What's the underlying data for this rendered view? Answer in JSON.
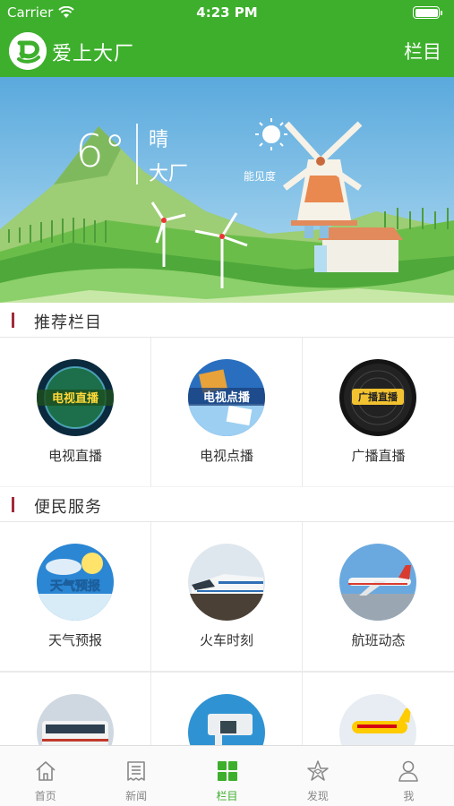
{
  "status_bar": {
    "carrier": "Carrier",
    "time": "4:23 PM"
  },
  "nav": {
    "title": "爱上大厂",
    "right_label": "栏目"
  },
  "weather": {
    "temperature": "6°",
    "condition": "晴",
    "city": "大厂",
    "visibility": "能见度"
  },
  "sections": [
    {
      "title": "推荐栏目",
      "items": [
        {
          "label": "电视直播",
          "icon": "tv-live-thumb",
          "thumb_text": "电视直播"
        },
        {
          "label": "电视点播",
          "icon": "tv-vod-thumb",
          "thumb_text": "电视点播"
        },
        {
          "label": "广播直播",
          "icon": "radio-live-thumb",
          "thumb_text": "广播直播"
        }
      ]
    },
    {
      "title": "便民服务",
      "items": [
        {
          "label": "天气预报",
          "icon": "weather-forecast-thumb",
          "thumb_text": "天气预报"
        },
        {
          "label": "火车时刻",
          "icon": "train-timetable-thumb"
        },
        {
          "label": "航班动态",
          "icon": "flight-status-thumb"
        }
      ]
    }
  ],
  "partial_row": [
    {
      "icon": "bus-thumb"
    },
    {
      "icon": "cctv-camera-thumb"
    },
    {
      "icon": "express-plane-thumb"
    }
  ],
  "tabs": [
    {
      "label": "首页",
      "icon": "home-icon",
      "active": false
    },
    {
      "label": "新闻",
      "icon": "news-icon",
      "active": false
    },
    {
      "label": "栏目",
      "icon": "grid-icon",
      "active": true
    },
    {
      "label": "发现",
      "icon": "discover-icon",
      "active": false
    },
    {
      "label": "我",
      "icon": "profile-icon",
      "active": false
    }
  ],
  "colors": {
    "brand": "#3daf2c",
    "section_marker": "#a12a3a",
    "text": "#333333",
    "tab_inactive": "#888888"
  }
}
